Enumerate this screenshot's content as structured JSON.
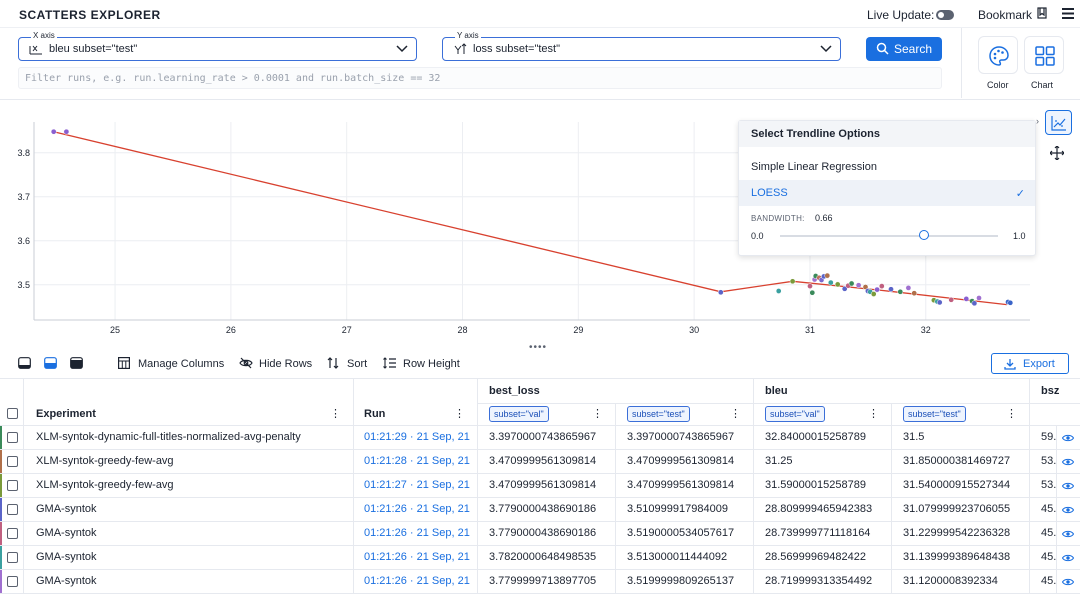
{
  "header": {
    "title": "SCATTERS EXPLORER",
    "live_update_label": "Live Update:",
    "bookmark_label": "Bookmark"
  },
  "x_axis": {
    "caption": "X axis",
    "value": "bleu subset=\"test\""
  },
  "y_axis": {
    "caption": "Y axis",
    "value": "loss subset=\"test\""
  },
  "search_label": "Search",
  "filter_placeholder": "Filter runs, e.g. run.learning_rate > 0.0001 and run.batch_size == 32",
  "side_tools": {
    "color_label": "Color",
    "chart_label": "Chart"
  },
  "trendline": {
    "title": "Select Trendline Options",
    "options": [
      "Simple Linear Regression",
      "LOESS"
    ],
    "selected": "LOESS",
    "bandwidth_label": "BANDWIDTH:",
    "bandwidth_value": "0.66",
    "bandwidth": 0.66,
    "min": "0.0",
    "max": "1.0"
  },
  "chart_data": {
    "type": "scatter",
    "xlabel": "",
    "ylabel": "",
    "xlim": [
      24.3,
      32.9
    ],
    "ylim": [
      3.42,
      3.87
    ],
    "x_ticks": [
      "25",
      "26",
      "27",
      "28",
      "29",
      "30",
      "31",
      "32"
    ],
    "y_ticks": [
      "3.8",
      "3.7",
      "3.6",
      "3.5"
    ],
    "grid": true,
    "points": [
      [
        24.47,
        3.848,
        "#8a5fd0"
      ],
      [
        24.58,
        3.848,
        "#8a5fd0"
      ],
      [
        30.23,
        3.483,
        "#5b64c8"
      ],
      [
        30.73,
        3.486,
        "#3aa0a0"
      ],
      [
        30.85,
        3.508,
        "#7a9a3a"
      ],
      [
        31.0,
        3.497,
        "#c06080"
      ],
      [
        31.02,
        3.482,
        "#3a8a5a"
      ],
      [
        31.04,
        3.512,
        "#a070d0"
      ],
      [
        31.05,
        3.52,
        "#3a8a5a"
      ],
      [
        31.08,
        3.516,
        "#c07060"
      ],
      [
        31.1,
        3.511,
        "#7a6ad0"
      ],
      [
        31.12,
        3.519,
        "#5b64c8"
      ],
      [
        31.15,
        3.521,
        "#b0704a"
      ],
      [
        31.18,
        3.505,
        "#3aa0a0"
      ],
      [
        31.24,
        3.501,
        "#7a9a3a"
      ],
      [
        31.3,
        3.491,
        "#5b64c8"
      ],
      [
        31.33,
        3.498,
        "#c06080"
      ],
      [
        31.36,
        3.503,
        "#3a8a5a"
      ],
      [
        31.42,
        3.499,
        "#a070d0"
      ],
      [
        31.48,
        3.495,
        "#b0704a"
      ],
      [
        31.5,
        3.486,
        "#5b64c8"
      ],
      [
        31.52,
        3.484,
        "#3aa0a0"
      ],
      [
        31.55,
        3.479,
        "#7a9a3a"
      ],
      [
        31.58,
        3.489,
        "#8a5fd0"
      ],
      [
        31.62,
        3.497,
        "#c06080"
      ],
      [
        31.7,
        3.49,
        "#5b64c8"
      ],
      [
        31.78,
        3.484,
        "#3a8a5a"
      ],
      [
        31.85,
        3.493,
        "#a070d0"
      ],
      [
        31.9,
        3.481,
        "#b0704a"
      ],
      [
        32.07,
        3.465,
        "#7a9a3a"
      ],
      [
        32.1,
        3.462,
        "#3aa0a0"
      ],
      [
        32.12,
        3.46,
        "#5b64c8"
      ],
      [
        32.22,
        3.466,
        "#c06080"
      ],
      [
        32.35,
        3.468,
        "#8a5fd0"
      ],
      [
        32.4,
        3.463,
        "#3a8a5a"
      ],
      [
        32.42,
        3.458,
        "#5b64c8"
      ],
      [
        32.46,
        3.47,
        "#a070d0"
      ],
      [
        32.71,
        3.461,
        "#3a64c8"
      ],
      [
        32.73,
        3.459,
        "#3a64c8"
      ]
    ],
    "trendline": [
      [
        24.47,
        3.848
      ],
      [
        30.23,
        3.484
      ],
      [
        30.85,
        3.508
      ],
      [
        31.6,
        3.488
      ],
      [
        32.7,
        3.455
      ]
    ]
  },
  "toolbar": {
    "manage_columns": "Manage Columns",
    "hide_rows": "Hide Rows",
    "sort": "Sort",
    "row_height": "Row Height",
    "export": "Export",
    "drag_handle": "••••"
  },
  "table": {
    "groups": {
      "best_loss": "best_loss",
      "bleu": "bleu",
      "bsz": "bsz"
    },
    "headers": {
      "experiment": "Experiment",
      "run": "Run"
    },
    "chips": {
      "val": "subset=\"val\"",
      "test": "subset=\"test\""
    },
    "rows": [
      {
        "experiment": "XLM-syntok-dynamic-full-titles-normalized-avg-penalty",
        "run": "01:21:29 · 21 Sep, 21",
        "loss_val": "3.3970000743865967",
        "loss_test": "3.3970000743865967",
        "bleu_val": "32.84000015258789",
        "bleu_test": "31.5",
        "bsz": "59.",
        "color": "#3a8a5a"
      },
      {
        "experiment": "XLM-syntok-greedy-few-avg",
        "run": "01:21:28 · 21 Sep, 21",
        "loss_val": "3.4709999561309814",
        "loss_test": "3.4709999561309814",
        "bleu_val": "31.25",
        "bleu_test": "31.850000381469727",
        "bsz": "53.",
        "color": "#b0704a"
      },
      {
        "experiment": "XLM-syntok-greedy-few-avg",
        "run": "01:21:27 · 21 Sep, 21",
        "loss_val": "3.4709999561309814",
        "loss_test": "3.4709999561309814",
        "bleu_val": "31.59000015258789",
        "bleu_test": "31.540000915527344",
        "bsz": "53.",
        "color": "#7a9a3a"
      },
      {
        "experiment": "GMA-syntok",
        "run": "01:21:26 · 21 Sep, 21",
        "loss_val": "3.7790000438690186",
        "loss_test": "3.510999917984009",
        "bleu_val": "28.809999465942383",
        "bleu_test": "31.079999923706055",
        "bsz": "45.",
        "color": "#5b64c8"
      },
      {
        "experiment": "GMA-syntok",
        "run": "01:21:26 · 21 Sep, 21",
        "loss_val": "3.7790000438690186",
        "loss_test": "3.5190000534057617",
        "bleu_val": "28.739999771118164",
        "bleu_test": "31.229999542236328",
        "bsz": "45.",
        "color": "#c06080"
      },
      {
        "experiment": "GMA-syntok",
        "run": "01:21:26 · 21 Sep, 21",
        "loss_val": "3.7820000648498535",
        "loss_test": "3.513000011444092",
        "bleu_val": "28.56999969482422",
        "bleu_test": "31.139999389648438",
        "bsz": "45.",
        "color": "#3aa0a0"
      },
      {
        "experiment": "GMA-syntok",
        "run": "01:21:26 · 21 Sep, 21",
        "loss_val": "3.7799999713897705",
        "loss_test": "3.5199999809265137",
        "bleu_val": "28.719999313354492",
        "bleu_test": "31.1200008392334",
        "bsz": "45.",
        "color": "#a070d0"
      }
    ]
  }
}
